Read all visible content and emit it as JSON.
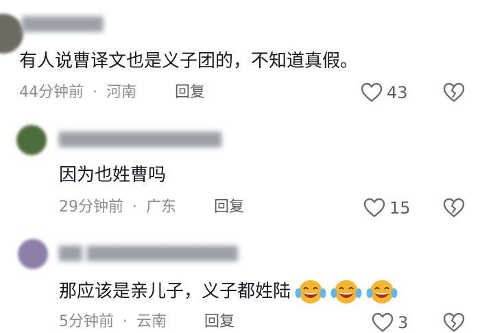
{
  "comments": [
    {
      "text": "有人说曹译文也是义子团的，不知道真假。",
      "time": "44分钟前",
      "location": "河南",
      "reply_label": "回复",
      "likes": "43"
    },
    {
      "text": "因为也姓曹吗",
      "time": "29分钟前",
      "location": "广东",
      "reply_label": "回复",
      "likes": "15"
    },
    {
      "text": "那应该是亲儿子，义子都姓陆",
      "time": "5分钟前",
      "location": "云南",
      "reply_label": "回复",
      "likes": "3"
    }
  ],
  "separator": "·",
  "colors": {
    "text": "#161823",
    "meta": "#8a8b91",
    "icon": "#6b6c72",
    "emoji_face": "#f7b52c"
  }
}
